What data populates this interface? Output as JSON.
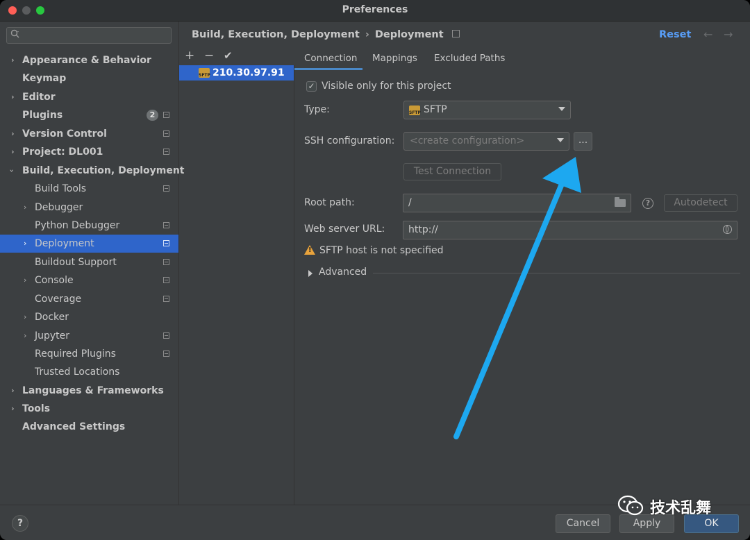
{
  "window": {
    "title": "Preferences"
  },
  "search": {
    "placeholder": ""
  },
  "sidebar": {
    "items": [
      {
        "label": "Appearance & Behavior",
        "expandable": true
      },
      {
        "label": "Keymap",
        "expandable": false
      },
      {
        "label": "Editor",
        "expandable": true
      },
      {
        "label": "Plugins",
        "badge": "2"
      },
      {
        "label": "Version Control",
        "expandable": true
      },
      {
        "label": "Project: DL001",
        "expandable": true
      },
      {
        "label": "Build, Execution, Deployment",
        "expanded": true
      },
      {
        "label": "Build Tools"
      },
      {
        "label": "Debugger",
        "expandable": true
      },
      {
        "label": "Python Debugger"
      },
      {
        "label": "Deployment",
        "selected": true
      },
      {
        "label": "Buildout Support"
      },
      {
        "label": "Console",
        "expandable": true
      },
      {
        "label": "Coverage"
      },
      {
        "label": "Docker",
        "expandable": true
      },
      {
        "label": "Jupyter",
        "expandable": true
      },
      {
        "label": "Required Plugins"
      },
      {
        "label": "Trusted Locations"
      },
      {
        "label": "Languages & Frameworks",
        "expandable": true
      },
      {
        "label": "Tools",
        "expandable": true
      },
      {
        "label": "Advanced Settings"
      }
    ]
  },
  "header": {
    "breadcrumb_parent": "Build, Execution, Deployment",
    "breadcrumb_sep": "›",
    "breadcrumb_current": "Deployment",
    "reset_label": "Reset",
    "back_arrow": "←",
    "forward_arrow": "→"
  },
  "servers": {
    "toolbar": {
      "add": "+",
      "remove": "−",
      "check": "✔"
    },
    "items": [
      {
        "name": "210.30.97.91",
        "icon": "sftp-icon"
      }
    ]
  },
  "tabs": [
    {
      "label": "Connection",
      "active": true
    },
    {
      "label": "Mappings"
    },
    {
      "label": "Excluded Paths"
    }
  ],
  "form": {
    "visible_only_label": "Visible only for this project",
    "visible_only_checked": true,
    "check_mark": "✓",
    "type_label": "Type:",
    "type_value": "SFTP",
    "ssh_label": "SSH configuration:",
    "ssh_value": "<create configuration>",
    "ssh_browse_label": "...",
    "test_connection_label": "Test Connection",
    "root_path_label": "Root path:",
    "root_path_value": "/",
    "help_label": "?",
    "autodetect_label": "Autodetect",
    "web_url_label": "Web server URL:",
    "web_url_value": "http://",
    "warning_text": "SFTP host is not specified",
    "advanced_label": "Advanced"
  },
  "footer": {
    "help_label": "?",
    "cancel_label": "Cancel",
    "apply_label": "Apply",
    "ok_label": "OK"
  },
  "watermark": {
    "text": "技术乱舞"
  },
  "colors": {
    "accent_blue": "#2f65ca",
    "link_blue": "#589df6",
    "annotation_arrow": "#1da8f0",
    "warning": "#e8a33c"
  }
}
